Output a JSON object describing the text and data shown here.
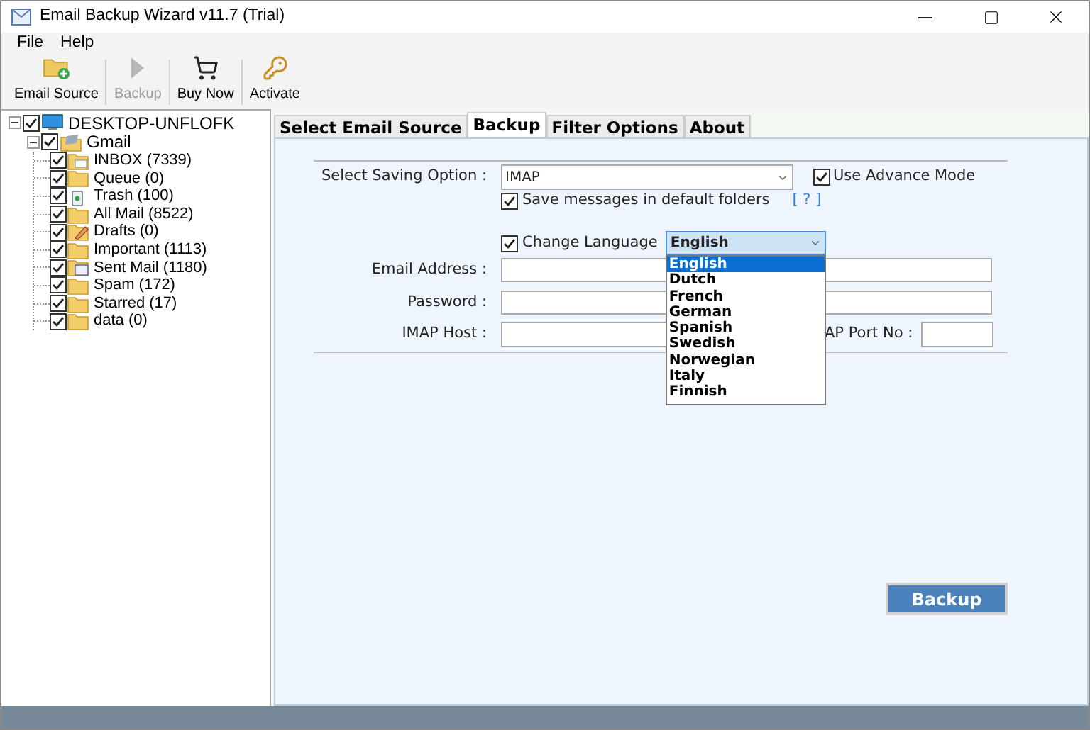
{
  "window": {
    "title": "Email Backup Wizard v11.7 (Trial)"
  },
  "menu": [
    "File",
    "Help"
  ],
  "toolbar": [
    {
      "label": "Email Source",
      "kind": "source",
      "disabled": false
    },
    {
      "label": "Backup",
      "kind": "backup",
      "disabled": true
    },
    {
      "label": "Buy Now",
      "kind": "cart",
      "disabled": false
    },
    {
      "label": "Activate",
      "kind": "key",
      "disabled": false
    }
  ],
  "tree": {
    "label": "DESKTOP-UNFLOFK",
    "checked": true,
    "expanded": true,
    "children": [
      {
        "label": "Gmail",
        "checked": true,
        "expanded": true,
        "children": [
          {
            "label": "INBOX (7339)",
            "checked": true,
            "kind": "inbox"
          },
          {
            "label": "Queue (0)",
            "checked": true,
            "kind": "folder"
          },
          {
            "label": "Trash (100)",
            "checked": true,
            "kind": "trash"
          },
          {
            "label": "All Mail (8522)",
            "checked": true,
            "kind": "folder"
          },
          {
            "label": "Drafts (0)",
            "checked": true,
            "kind": "drafts"
          },
          {
            "label": "Important (1113)",
            "checked": true,
            "kind": "folder"
          },
          {
            "label": "Sent Mail (1180)",
            "checked": true,
            "kind": "sent"
          },
          {
            "label": "Spam (172)",
            "checked": true,
            "kind": "folder"
          },
          {
            "label": "Starred (17)",
            "checked": true,
            "kind": "folder"
          },
          {
            "label": "data (0)",
            "checked": true,
            "kind": "folder"
          }
        ]
      }
    ]
  },
  "tabs": [
    {
      "label": "Select Email Source",
      "selected": false
    },
    {
      "label": "Backup",
      "selected": true
    },
    {
      "label": "Filter Options",
      "selected": false
    },
    {
      "label": "About",
      "selected": false
    }
  ],
  "form": {
    "saving_option": {
      "label": "Select Saving Option :",
      "value": "IMAP"
    },
    "advance_mode": {
      "label": "Use Advance Mode",
      "checked": true
    },
    "default_folders": {
      "label": "Save messages in default folders",
      "checked": true
    },
    "help_link": "[ ? ]",
    "change_language": {
      "label": "Change Language",
      "checked": true,
      "value": "English",
      "expanded": true,
      "options": [
        {
          "label": "English",
          "selected": true
        },
        {
          "label": "Dutch",
          "selected": false
        },
        {
          "label": "French",
          "selected": false
        },
        {
          "label": "German",
          "selected": false
        },
        {
          "label": "Spanish",
          "selected": false
        },
        {
          "label": "Swedish",
          "selected": false
        },
        {
          "label": "Norwegian",
          "selected": false
        },
        {
          "label": "Italy",
          "selected": false
        },
        {
          "label": "Finnish",
          "selected": false
        }
      ]
    },
    "email_address": {
      "label": "Email Address :"
    },
    "password": {
      "label": "Password :"
    },
    "imap_host": {
      "label": "IMAP Host :"
    },
    "port": {
      "label": "AP Port No :"
    }
  },
  "backup_button": "Backup"
}
